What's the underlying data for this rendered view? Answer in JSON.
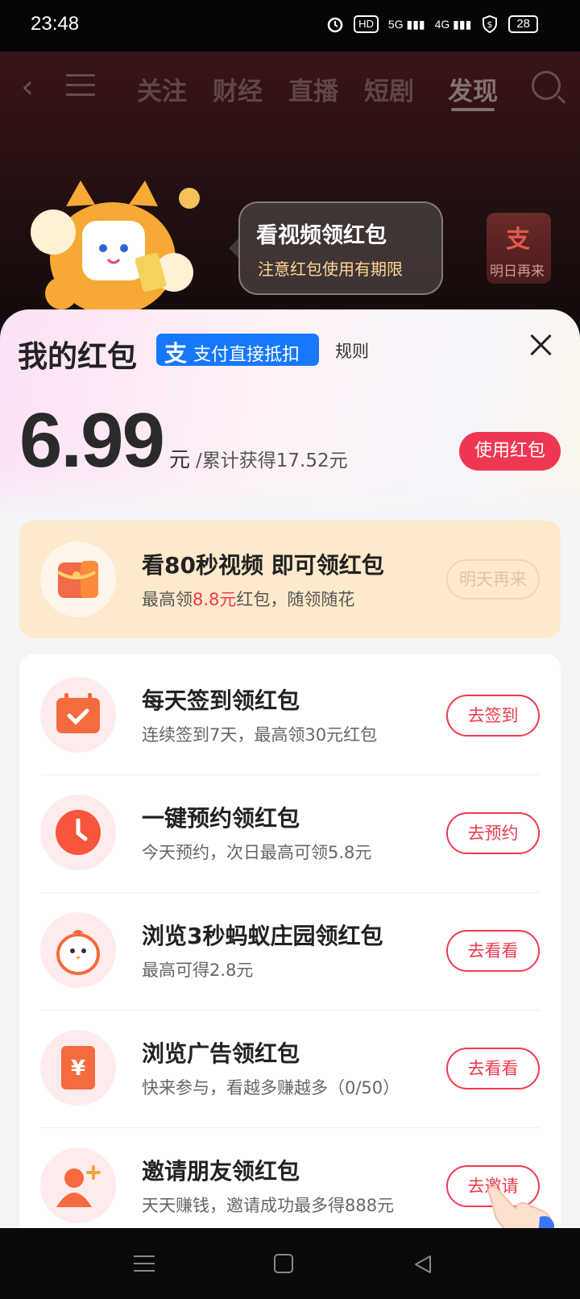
{
  "status_bar": {
    "time": "23:48",
    "hd_label": "HD",
    "signal1": "5G",
    "signal2": "4G",
    "battery": "28"
  },
  "top_nav": {
    "tabs": [
      {
        "label": "关注"
      },
      {
        "label": "财经"
      },
      {
        "label": "直播"
      },
      {
        "label": "短剧"
      },
      {
        "label": "发现",
        "active": true
      }
    ]
  },
  "banner": {
    "bubble_title": "看视频领红包",
    "bubble_subtitle": "注意红包使用有期限",
    "badge_icon": "支",
    "badge_label": "明日再来"
  },
  "sheet": {
    "title": "我的红包",
    "alipay_icon": "支",
    "alipay_badge": "支付直接抵扣",
    "rules": "规则",
    "amount": "6.99",
    "amount_unit": "元",
    "amount_total": "/累计获得17.52元",
    "use_button": "使用红包"
  },
  "video_card": {
    "title": "看80秒视频 即可领红包",
    "sub_prefix": "最高领",
    "sub_highlight": "8.8元",
    "sub_suffix": "红包，随领随花",
    "button": "明天再来"
  },
  "tasks": [
    {
      "icon": "calendar-check-icon",
      "title": "每天签到领红包",
      "subtitle": "连续签到7天，最高领30元红包",
      "button": "去签到"
    },
    {
      "icon": "clock-icon",
      "title": "一键预约领红包",
      "subtitle": "今天预约，次日最高可领5.8元",
      "button": "去预约"
    },
    {
      "icon": "chick-icon",
      "title": "浏览3秒蚂蚁庄园领红包",
      "subtitle": "最高可得2.8元",
      "button": "去看看"
    },
    {
      "icon": "yuan-card-icon",
      "title": "浏览广告领红包",
      "subtitle": "快来参与，看越多赚越多（0/50）",
      "button": "去看看"
    },
    {
      "icon": "add-user-icon",
      "title": "邀请朋友领红包",
      "subtitle": "天天赚钱，邀请成功最多得888元",
      "button": "去邀请"
    }
  ],
  "colors": {
    "accent_red": "#f03752",
    "alipay_blue": "#1677ff",
    "card_orange": "#fde9cb"
  }
}
